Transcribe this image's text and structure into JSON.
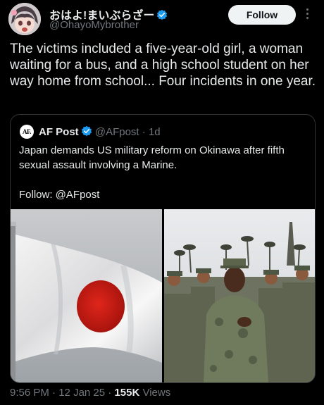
{
  "author": {
    "name": "おはよ!まいぶらざー",
    "handle": "@OhayoMybrother"
  },
  "follow_label": "Follow",
  "tweet_text": "The victims included a five-year-old girl, a woman waiting for a bus, and a high school student on her way home from school... Four incidents in one year.",
  "quote": {
    "avatar_text": "AF.",
    "name": "AF Post",
    "handle": "@AFpost",
    "separator": "·",
    "time": "1d",
    "text": "Japan demands US military reform on Okinawa after fifth sexual assault involving a Marine.",
    "follow_line": "Follow: @AFpost"
  },
  "meta": {
    "time": "9:56 PM",
    "sep1": " · ",
    "date": "12 Jan 25",
    "sep2": " · ",
    "views": "155K",
    "views_label": "Views"
  },
  "colors": {
    "background": "#000000",
    "text": "#e7e9ea",
    "muted": "#71767b",
    "verified": "#1d9bf0",
    "border": "#2f3336"
  },
  "icons": [
    "verified-badge-icon",
    "more-options-icon",
    "flag-photo",
    "soldiers-photo"
  ]
}
